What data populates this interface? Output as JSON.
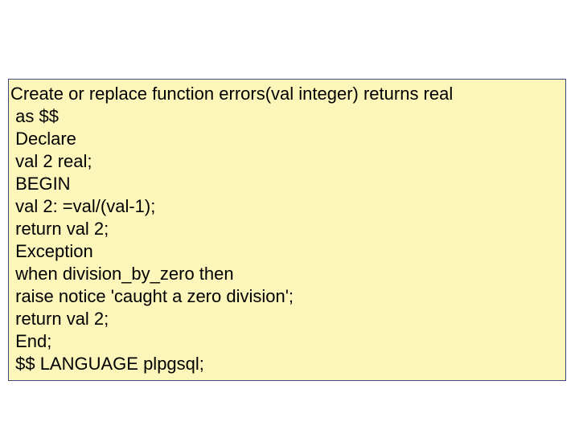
{
  "code": {
    "lines": [
      "Create or replace function errors(val integer) returns real",
      " as $$",
      " Declare",
      " val 2 real;",
      " BEGIN",
      " val 2: =val/(val-1);",
      " return val 2;",
      " Exception",
      " when division_by_zero then",
      " raise notice 'caught a zero division';",
      " return val 2;",
      " End;",
      " $$ LANGUAGE plpgsql;"
    ]
  }
}
